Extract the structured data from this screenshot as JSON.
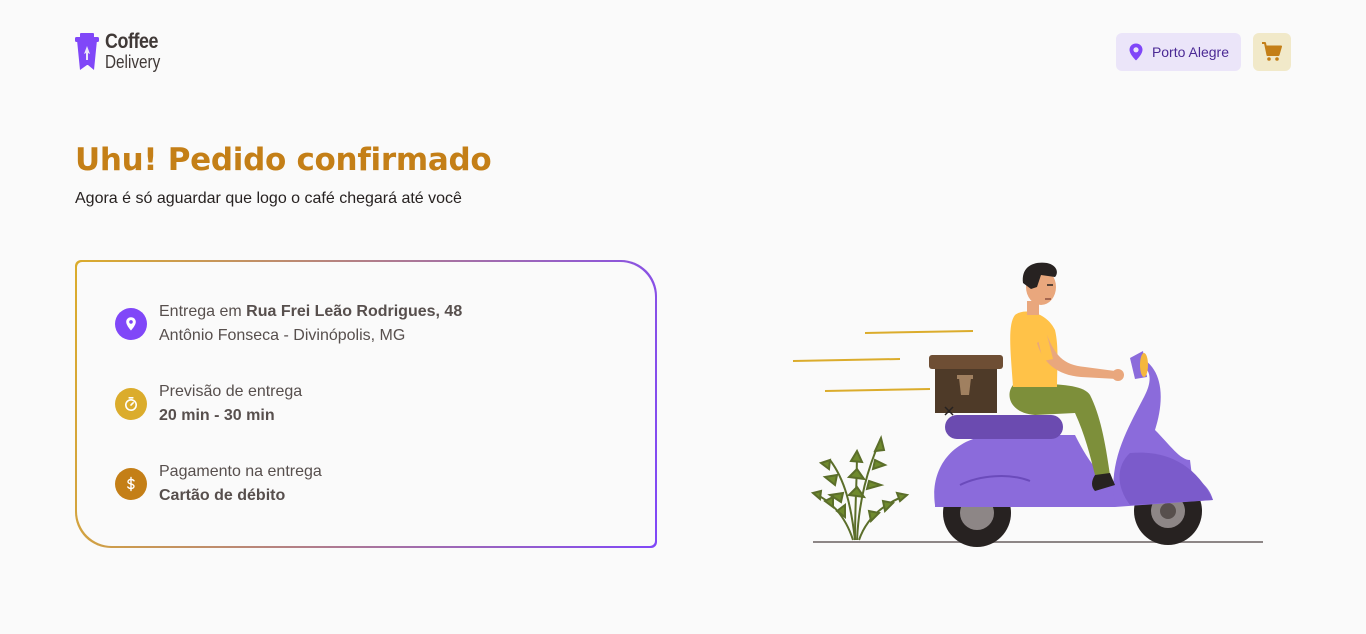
{
  "header": {
    "logo": {
      "line1": "Coffee",
      "line2": "Delivery"
    },
    "location": "Porto Alegre",
    "icons": {
      "location": "map-pin-icon",
      "cart": "shopping-cart-icon"
    }
  },
  "title": "Uhu! Pedido confirmado",
  "subtitle": "Agora é só aguardar que logo o café chegará até você",
  "order": {
    "address": {
      "prefix": "Entrega em ",
      "street": "Rua Frei Leão Rodrigues, 48",
      "district": "Antônio Fonseca - Divinópolis, MG",
      "icon": "map-pin-icon",
      "color": "#8047F8"
    },
    "delivery_time": {
      "label": "Previsão de entrega",
      "value": "20 min - 30 min",
      "icon": "timer-icon",
      "color": "#DBAC2C"
    },
    "payment": {
      "label": "Pagamento na entrega",
      "value": "Cartão de débito",
      "icon": "currency-dollar-icon",
      "color": "#C47F17"
    }
  },
  "colors": {
    "background": "#FAFAFA",
    "yellow_dark": "#C47F17",
    "yellow": "#DBAC2C",
    "purple": "#8047F8",
    "purple_dark": "#4B2995"
  }
}
